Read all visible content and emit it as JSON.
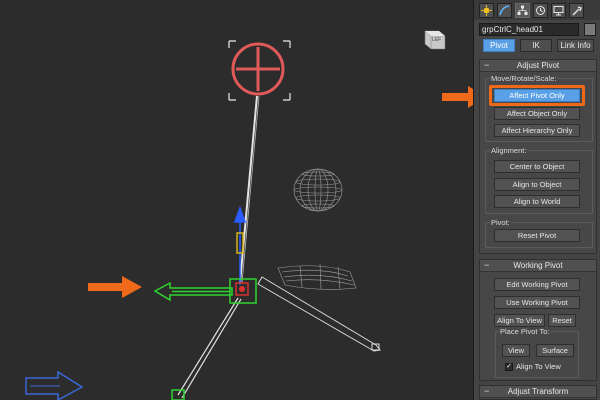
{
  "object_name": "grpCtrlC_head01",
  "sub_tabs": [
    "Pivot",
    "IK",
    "Link Info"
  ],
  "adjust_pivot": {
    "title": "Adjust Pivot",
    "move_group_label": "Move/Rotate/Scale:",
    "move_buttons": [
      "Affect Pivot Only",
      "Affect Object Only",
      "Affect Hierarchy Only"
    ],
    "alignment_label": "Alignment:",
    "alignment_buttons": [
      "Center to Object",
      "Align to Object",
      "Align to World"
    ],
    "pivot_label": "Pivot:",
    "reset_pivot": "Reset Pivot"
  },
  "working_pivot": {
    "title": "Working Pivot",
    "edit_button": "Edit Working Pivot",
    "use_button": "Use Working Pivot",
    "align_to_view": "Align To View",
    "reset": "Reset",
    "place_label": "Place Pivot To:",
    "view": "View",
    "surface": "Surface",
    "align_to_view_check": "Align To View"
  },
  "adjust_transform": {
    "title": "Adjust Transform"
  },
  "viewcube_label": "LEF",
  "colors": {
    "accent": "#5aa0e6",
    "highlight": "#ee6a1a",
    "circle_control": "#e05a5a",
    "selected_green": "#2ed42e"
  }
}
